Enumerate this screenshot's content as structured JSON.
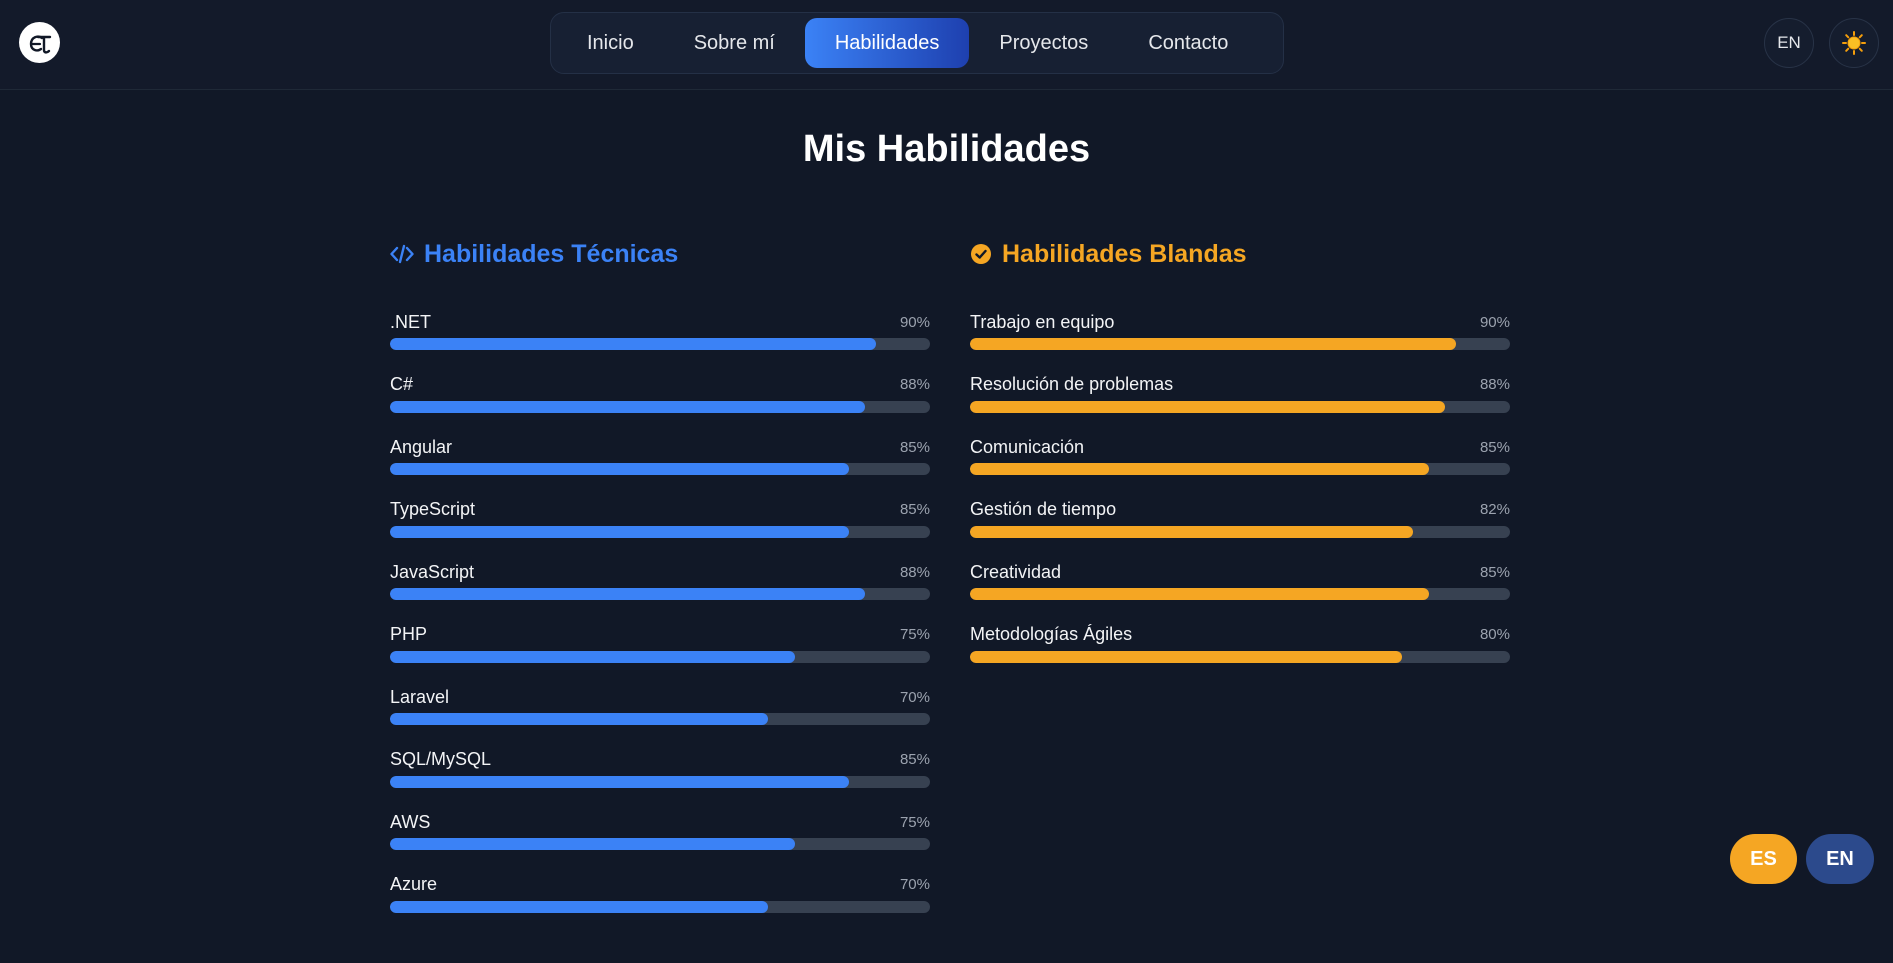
{
  "header": {
    "logo_icon": "logo-icon",
    "nav": [
      {
        "label": "Inicio",
        "active": false
      },
      {
        "label": "Sobre mí",
        "active": false
      },
      {
        "label": "Habilidades",
        "active": true
      },
      {
        "label": "Proyectos",
        "active": false
      },
      {
        "label": "Contacto",
        "active": false
      }
    ],
    "language_button": "EN",
    "theme_icon": "sun-icon"
  },
  "main": {
    "title": "Mis Habilidades",
    "technical": {
      "title": "Habilidades Técnicas",
      "icon": "code-icon",
      "accent": "#3b82f6",
      "skills": [
        {
          "name": ".NET",
          "percent_label": "90%",
          "value": 90
        },
        {
          "name": "C#",
          "percent_label": "88%",
          "value": 88
        },
        {
          "name": "Angular",
          "percent_label": "85%",
          "value": 85
        },
        {
          "name": "TypeScript",
          "percent_label": "85%",
          "value": 85
        },
        {
          "name": "JavaScript",
          "percent_label": "88%",
          "value": 88
        },
        {
          "name": "PHP",
          "percent_label": "75%",
          "value": 75
        },
        {
          "name": "Laravel",
          "percent_label": "70%",
          "value": 70
        },
        {
          "name": "SQL/MySQL",
          "percent_label": "85%",
          "value": 85
        },
        {
          "name": "AWS",
          "percent_label": "75%",
          "value": 75
        },
        {
          "name": "Azure",
          "percent_label": "70%",
          "value": 70
        }
      ]
    },
    "soft": {
      "title": "Habilidades Blandas",
      "icon": "check-circle-icon",
      "accent": "#f5a623",
      "skills": [
        {
          "name": "Trabajo en equipo",
          "percent_label": "90%",
          "value": 90
        },
        {
          "name": "Resolución de problemas",
          "percent_label": "88%",
          "value": 88
        },
        {
          "name": "Comunicación",
          "percent_label": "85%",
          "value": 85
        },
        {
          "name": "Gestión de tiempo",
          "percent_label": "82%",
          "value": 82
        },
        {
          "name": "Creatividad",
          "percent_label": "85%",
          "value": 85
        },
        {
          "name": "Metodologías Ágiles",
          "percent_label": "80%",
          "value": 80
        }
      ]
    }
  },
  "floating_language": {
    "es_label": "ES",
    "en_label": "EN",
    "es_color": "#f5a623",
    "en_color": "#2c4a8c"
  }
}
